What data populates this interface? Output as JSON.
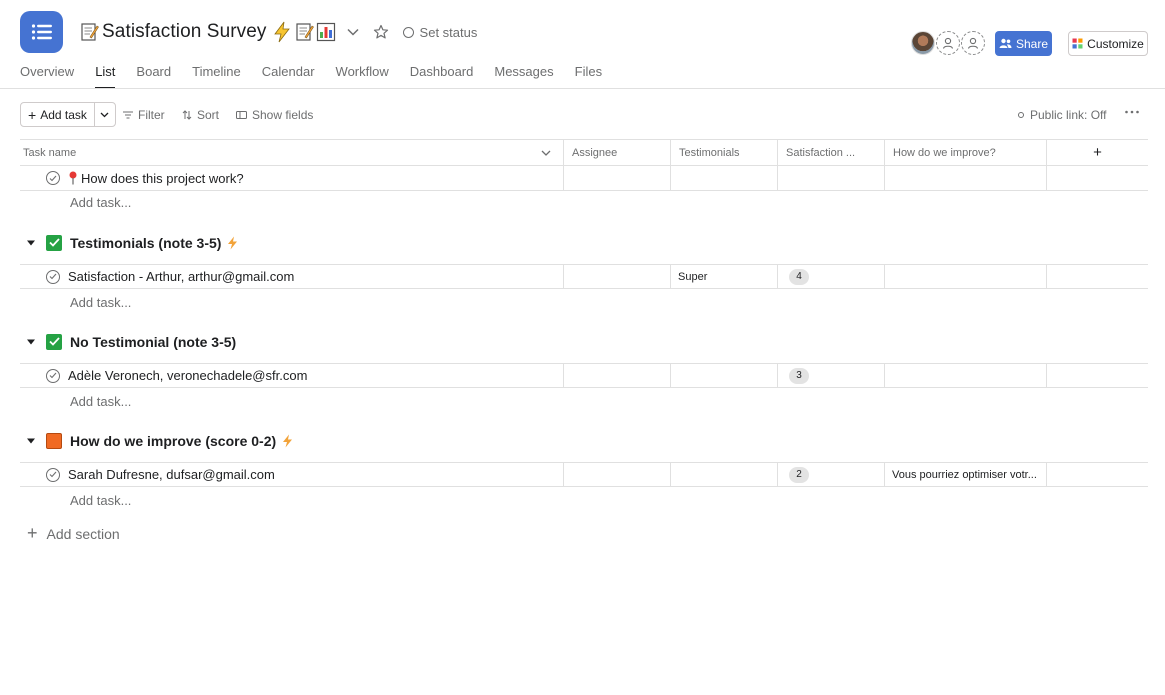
{
  "header": {
    "title": "Satisfaction Survey",
    "set_status": "Set status",
    "share": "Share",
    "customize": "Customize"
  },
  "tabs": [
    "Overview",
    "List",
    "Board",
    "Timeline",
    "Calendar",
    "Workflow",
    "Dashboard",
    "Messages",
    "Files"
  ],
  "active_tab": "List",
  "toolbar": {
    "add_task": "Add task",
    "filter": "Filter",
    "sort": "Sort",
    "show_fields": "Show fields",
    "public_link": "Public link: Off"
  },
  "columns": [
    "Task name",
    "Assignee",
    "Testimonials",
    "Satisfaction ...",
    "How do we improve?"
  ],
  "add_task_link": "Add task...",
  "add_section": "Add section",
  "intro_task": {
    "name": "How does this project work?"
  },
  "sections": [
    {
      "name": "Testimonials (note 3-5)",
      "color": "#25a244",
      "tasks": [
        {
          "name": "Satisfaction - Arthur, arthur@gmail.com",
          "testimonial": "Super",
          "satisfaction": "4",
          "improve": ""
        }
      ]
    },
    {
      "name": "No Testimonial (note 3-5)",
      "color": "#25a244",
      "tasks": [
        {
          "name": "Adèle Veronech, veronechadele@sfr.com",
          "testimonial": "",
          "satisfaction": "3",
          "improve": ""
        }
      ]
    },
    {
      "name": "How do we improve (score 0-2)",
      "color": "#f06a23",
      "tasks": [
        {
          "name": "Sarah Dufresne, dufsar@gmail.com",
          "testimonial": "",
          "satisfaction": "2",
          "improve": "Vous pourriez optimiser votr..."
        }
      ]
    }
  ],
  "colors": {
    "accent": "#4573d2",
    "bolt": "#f2a33a"
  }
}
